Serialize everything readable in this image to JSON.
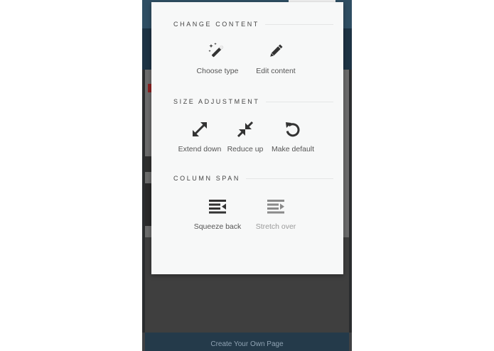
{
  "background": {
    "footer_text": "Create Your Own Page"
  },
  "menu": {
    "sections": [
      {
        "title": "CHANGE CONTENT",
        "items": [
          {
            "label": "Choose type",
            "icon": "magic-wand-icon",
            "enabled": true
          },
          {
            "label": "Edit content",
            "icon": "pencil-icon",
            "enabled": true
          }
        ]
      },
      {
        "title": "SIZE ADJUSTMENT",
        "items": [
          {
            "label": "Extend down",
            "icon": "expand-arrows-icon",
            "enabled": true
          },
          {
            "label": "Reduce up",
            "icon": "compress-arrows-icon",
            "enabled": true
          },
          {
            "label": "Make default",
            "icon": "undo-circle-icon",
            "enabled": true
          }
        ]
      },
      {
        "title": "COLUMN SPAN",
        "items": [
          {
            "label": "Squeeze back",
            "icon": "indent-left-icon",
            "enabled": true
          },
          {
            "label": "Stretch over",
            "icon": "indent-right-icon",
            "enabled": false
          }
        ]
      }
    ]
  },
  "colors": {
    "menu_bg": "#f7f8f8",
    "icon": "#333333",
    "icon_disabled": "#8a8a8a",
    "backdrop": "#3f4144",
    "header_strip": "#2f4e63"
  }
}
